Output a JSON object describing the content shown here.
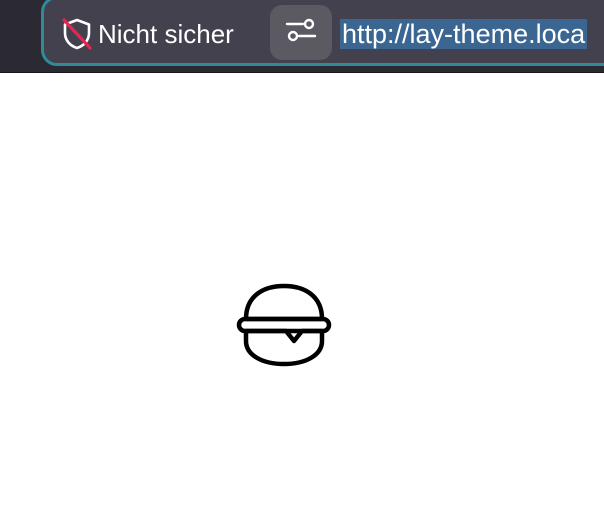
{
  "browser": {
    "security_label": "Nicht sicher",
    "security_icon": "shield-slash-icon",
    "permissions_icon": "sliders-icon",
    "url": "http://lay-theme.loca",
    "colors": {
      "toolbar_bg": "#2b2a33",
      "urlbar_bg": "#42414d",
      "focus_ring": "#2f8b9a",
      "selection": "#3b6692",
      "insecure_slash": "#e22850"
    }
  },
  "page": {
    "menu_icon": "hamburger-burger-icon"
  }
}
